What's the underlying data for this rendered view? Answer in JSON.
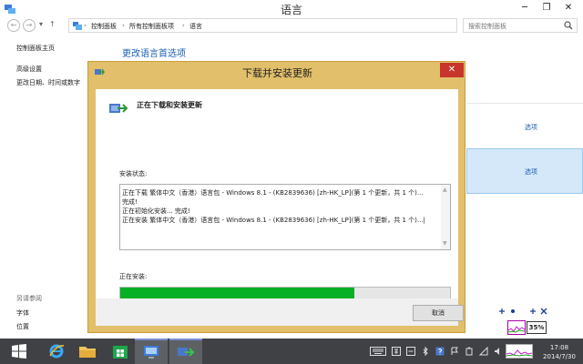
{
  "window": {
    "title": "语言",
    "minimize": "─",
    "restore": "❐",
    "close": "✕"
  },
  "address": {
    "back": "←",
    "forward": "→",
    "recent": "▾",
    "up": "↑",
    "crumbs": [
      "控制面板",
      "所有控制面板项",
      "语言"
    ],
    "separator": "›",
    "search_placeholder": "搜索控制面板"
  },
  "leftnav": {
    "items": [
      "控制面板主页",
      "高级设置",
      "更改日期、时间或数字"
    ],
    "see_also_title": "另请参阅",
    "see_also_items": [
      "字体",
      "位置"
    ]
  },
  "content": {
    "title": "更改语言首选项",
    "options": [
      "选项",
      "选项"
    ]
  },
  "dialog": {
    "title": "下载并安装更新",
    "close": "✕",
    "heading": "正在下载和安装更新",
    "status_label": "安装状态:",
    "log_lines": [
      "正在下载 繁体中文（香港）语言包 - Windows 8.1 - (KB2839636) [zh-HK_LP](第 1 个更新，共 1 个)...",
      "完成!",
      "正在初始化安装... 完成!",
      "正在安装 繁体中文（香港）语言包 - Windows 8.1 - (KB2839636) [zh-HK_LP](第 1 个更新，共 1 个)...|"
    ],
    "installing_label": "正在安装:",
    "progress": 0.71,
    "cancel_label": "取消",
    "scroll_up": "▲",
    "scroll_down": "▼"
  },
  "widgets": {
    "percent": "35%"
  },
  "taskbar": {
    "time": "17:08",
    "date": "2014/7/30"
  },
  "colors": {
    "accent": "#1a5fb4",
    "dialog_frame": "#e2bf6a",
    "progress_fill": "#06b025",
    "close_red": "#c7352b"
  }
}
